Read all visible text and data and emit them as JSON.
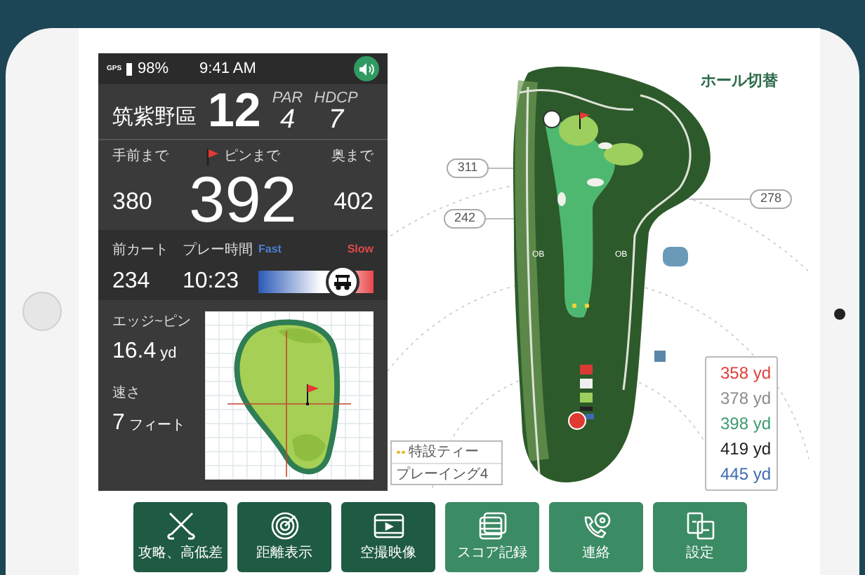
{
  "status_bar": {
    "gps": "GPS",
    "battery": "98%",
    "time": "9:41 AM",
    "sound_on": true
  },
  "hole": {
    "course": "筑紫野區",
    "number": "12",
    "par_label": "PAR",
    "par": "4",
    "hdcp_label": "HDCP",
    "hdcp": "7"
  },
  "distances": [
    {
      "kind": "front",
      "label": "手前まで",
      "value": "380"
    },
    {
      "kind": "pin",
      "label": "ピンまで",
      "value": "392"
    },
    {
      "kind": "back",
      "label": "奥まで",
      "value": "402"
    }
  ],
  "pace": {
    "cart_label": "前カート",
    "cart": "234",
    "time_label": "プレー時間",
    "time": "10:23",
    "fast": "Fast",
    "slow": "Slow",
    "level": 0.73
  },
  "green": {
    "edge_label": "エッジ~ピン",
    "edge": "16.4",
    "edge_unit": "yd",
    "speed_label": "速さ",
    "speed": "7",
    "speed_unit": "フィート"
  },
  "map": {
    "switch_label": "ホール切替",
    "markers": [
      "311",
      "242",
      "278"
    ],
    "ob": [
      "OB",
      "OB"
    ],
    "legend": [
      "特設ティー",
      "プレーイング4"
    ],
    "yardages": [
      {
        "value": "358",
        "unit": "yd",
        "color": "#e0403c"
      },
      {
        "value": "378",
        "unit": "yd",
        "color": "#8c8c8c"
      },
      {
        "value": "398",
        "unit": "yd",
        "color": "#3d9a6c"
      },
      {
        "value": "419",
        "unit": "yd",
        "color": "#1e1e1e"
      },
      {
        "value": "445",
        "unit": "yd",
        "color": "#3f6cb0"
      }
    ]
  },
  "toolbar": [
    {
      "kind": "clubs",
      "label": "攻略、高低差",
      "active": true
    },
    {
      "kind": "radar",
      "label": "距離表示",
      "active": true
    },
    {
      "kind": "video",
      "label": "空撮映像",
      "active": true
    },
    {
      "kind": "score",
      "label": "スコア記録",
      "active": false
    },
    {
      "kind": "phone",
      "label": "連絡",
      "active": false
    },
    {
      "kind": "settings",
      "label": "設定",
      "active": false
    }
  ]
}
